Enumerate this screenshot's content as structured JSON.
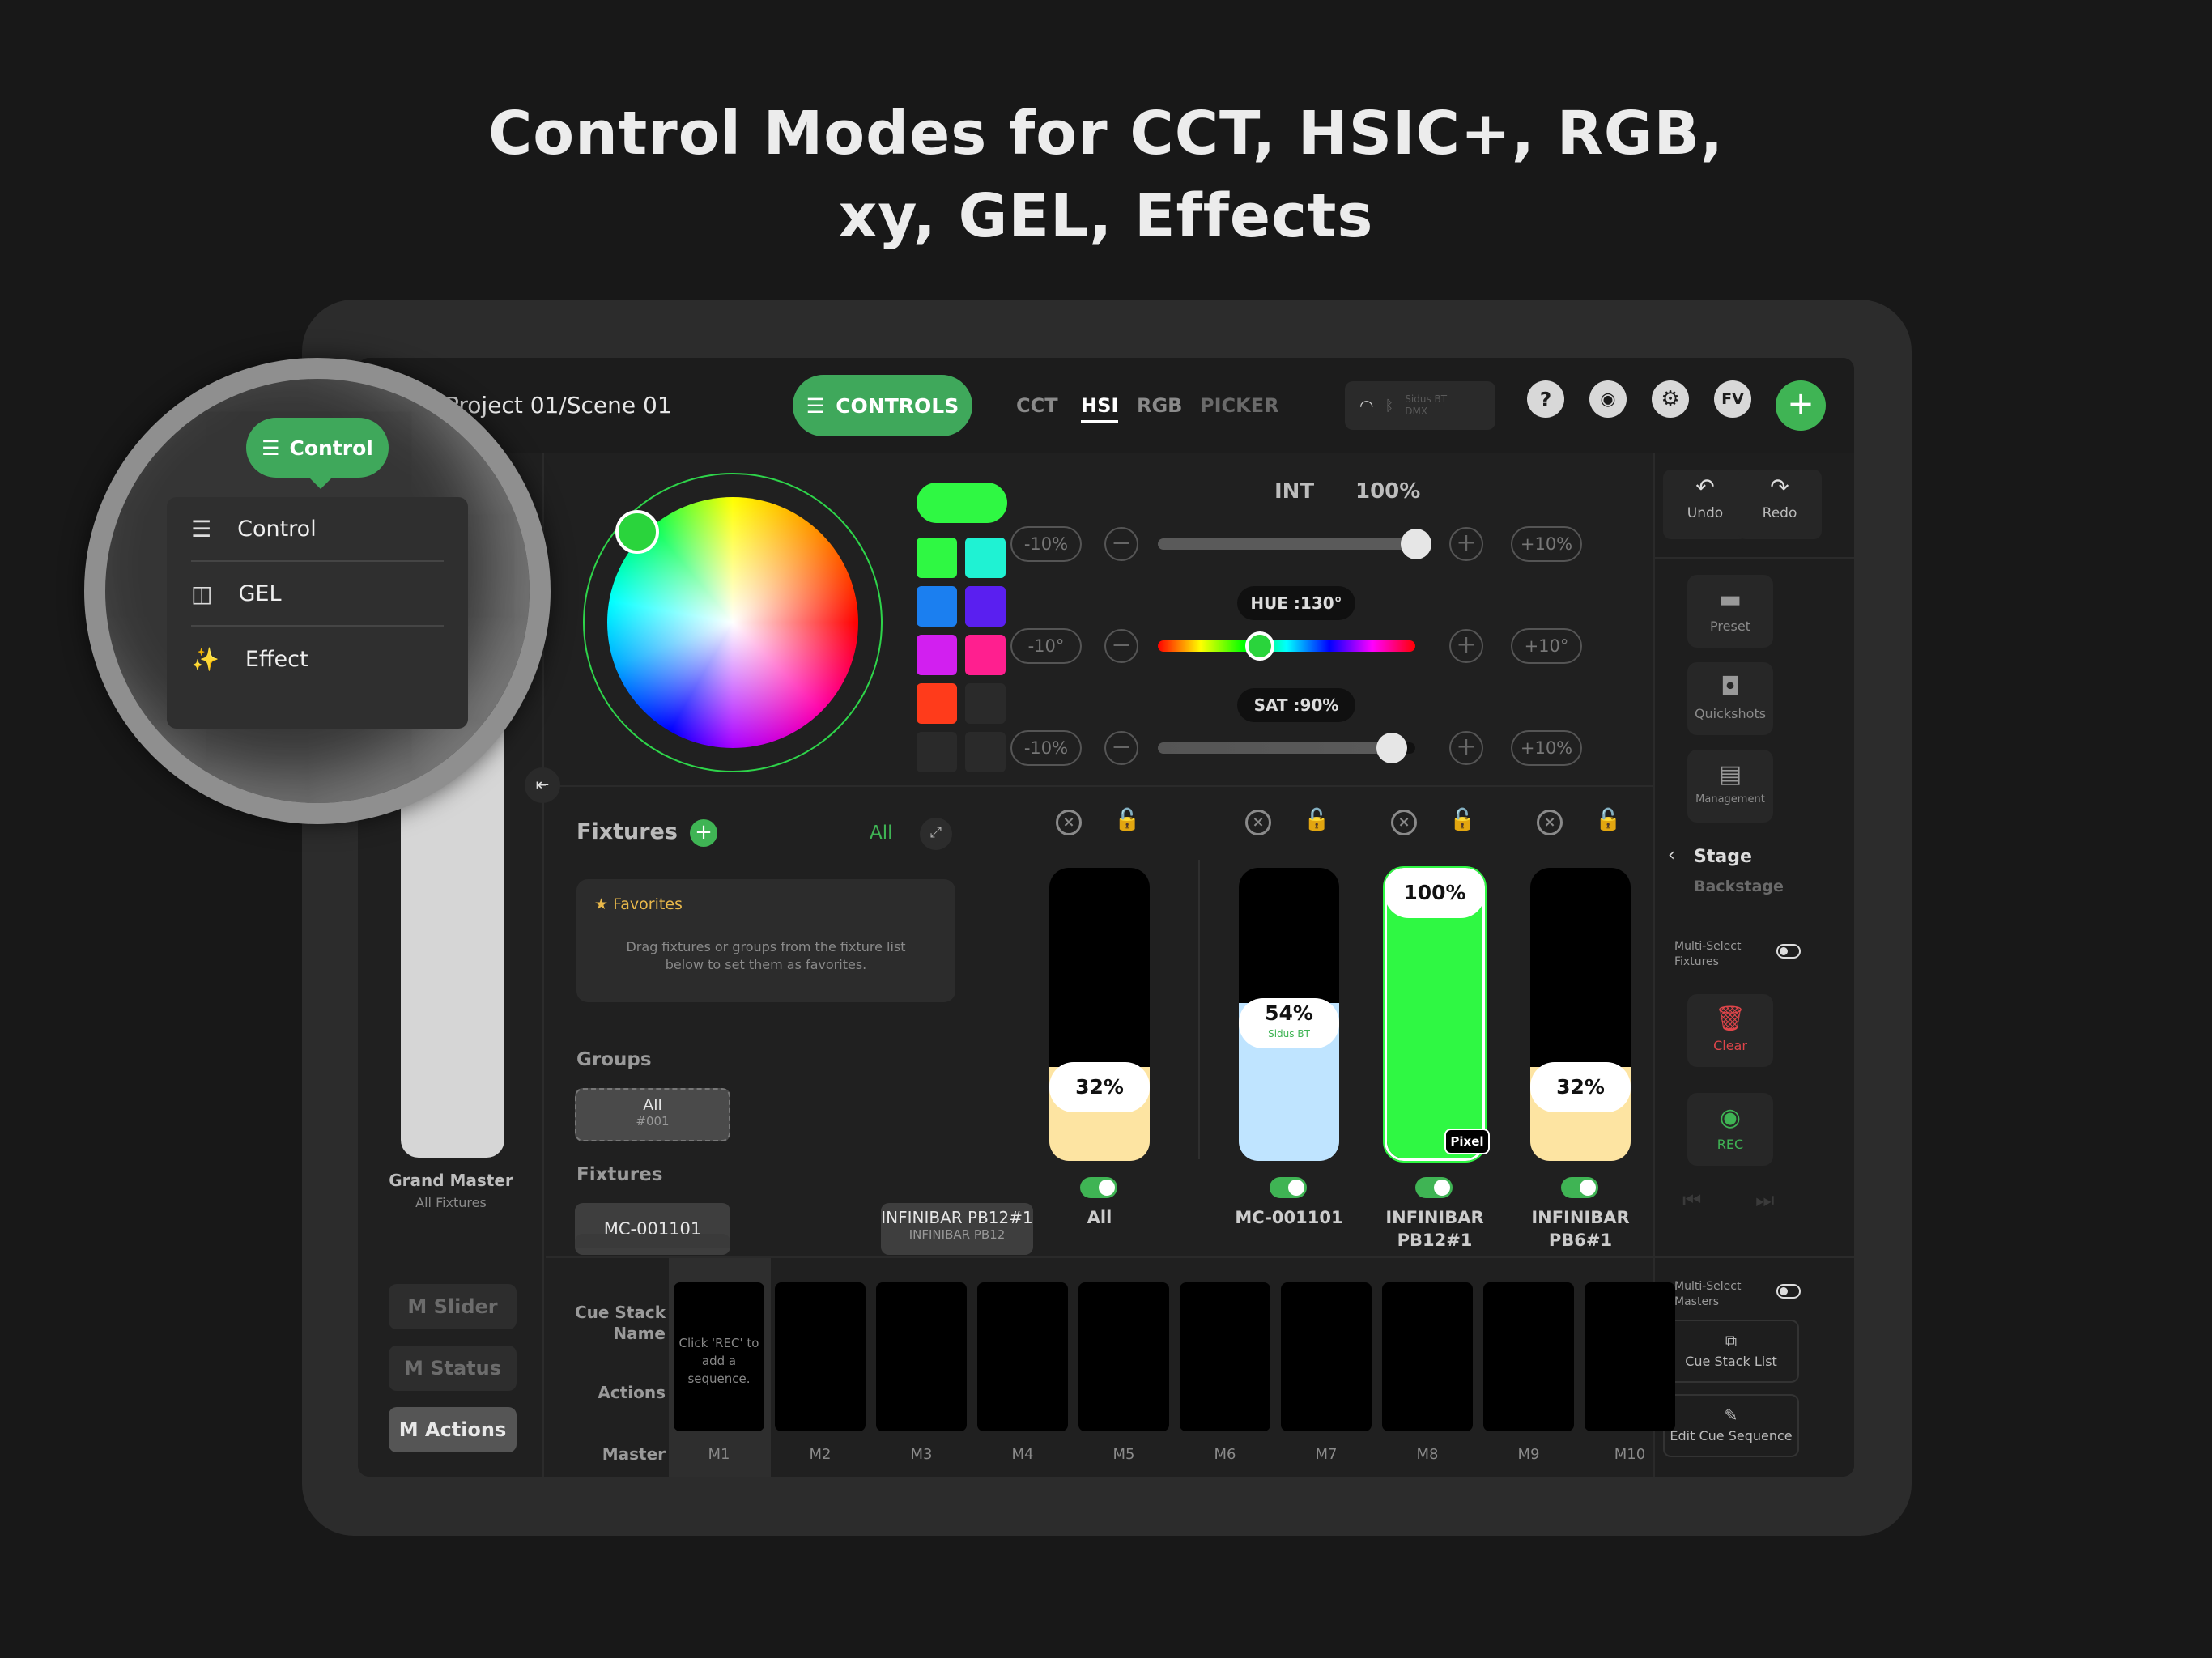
{
  "headline": {
    "line1": "Control Modes for CCT, HSIC+, RGB,",
    "line2": "xy, GEL, Effects"
  },
  "topbar": {
    "project": "Project 01/Scene 01",
    "controls_label": "CONTROLS",
    "tabs": [
      {
        "label": "CCT",
        "active": false
      },
      {
        "label": "HSI",
        "active": true
      },
      {
        "label": "RGB",
        "active": false
      },
      {
        "label": "PICKER",
        "active": false
      }
    ],
    "connection": {
      "line1": "Sidus BT",
      "line2": "DMX"
    },
    "user_initials": "FV",
    "help_label": "?",
    "add_label": "+"
  },
  "magnifier": {
    "button_label": "Control",
    "menu": [
      {
        "label": "Control",
        "icon": "sliders-icon"
      },
      {
        "label": "GEL",
        "icon": "gel-icon"
      },
      {
        "label": "Effect",
        "icon": "magic-wand-icon"
      }
    ]
  },
  "master": {
    "title": "Grand Master",
    "subtitle": "All Fixtures",
    "buttons": [
      {
        "label": "M Slider",
        "active": false
      },
      {
        "label": "M Status",
        "active": false
      },
      {
        "label": "M Actions",
        "active": true
      }
    ]
  },
  "color": {
    "swatches": [
      "#2ff843",
      "#1ff2d3",
      "#1b7ff0",
      "#5a1ff0",
      "#d21ff0",
      "#ff1f8f",
      "#ff3b1b",
      "#2a2a2a",
      "#2a2a2a",
      "#2a2a2a"
    ],
    "active_swatch": "#2ff843",
    "int_label": "INT",
    "int_value": "100%",
    "int_level": 1.0,
    "hue_tag": "HUE :130°",
    "hue_deg": 130,
    "sat_tag": "SAT :90%",
    "sat_level": 0.9,
    "rows": [
      {
        "left": "-10%",
        "right": "+10%"
      },
      {
        "left": "-10°",
        "right": "+10°"
      },
      {
        "left": "-10%",
        "right": "+10%"
      }
    ]
  },
  "fixtures_panel": {
    "title": "Fixtures",
    "filter": "All",
    "favorites_title": "Favorites",
    "favorites_hint_1": "Drag fixtures or groups from the fixture list",
    "favorites_hint_2": "below to set them as favorites.",
    "groups_title": "Groups",
    "group": {
      "name": "All",
      "id": "#001"
    },
    "fixtures_title": "Fixtures",
    "fixtures": [
      {
        "name": "MC-001101",
        "sub": ""
      },
      {
        "name": "INFINIBAR PB12#1",
        "sub": "INFINIBAR PB12"
      }
    ]
  },
  "faders": [
    {
      "label": "All",
      "label2": "",
      "value": "32%",
      "level": 0.32,
      "fill": "#fde4a2",
      "sub": "",
      "badge": ""
    },
    {
      "label": "MC-001101",
      "label2": "",
      "value": "54%",
      "level": 0.54,
      "fill": "#bfe4ff",
      "sub": "Sidus BT",
      "badge": ""
    },
    {
      "label": "INFINIBAR",
      "label2": "PB12#1",
      "value": "100%",
      "level": 1.0,
      "fill": "#2ff843",
      "sub": "",
      "badge": "Pixel"
    },
    {
      "label": "INFINIBAR",
      "label2": "PB6#1",
      "value": "32%",
      "level": 0.32,
      "fill": "#fde4a2",
      "sub": "",
      "badge": ""
    }
  ],
  "right": {
    "undo": "Undo",
    "redo": "Redo",
    "preset": "Preset",
    "quickshots": "Quickshots",
    "management": "Management",
    "stage": "Stage",
    "backstage": "Backstage",
    "multi_fixtures": "Multi-Select Fixtures",
    "clear": "Clear",
    "rec": "REC",
    "multi_masters": "Multi-Select Masters",
    "cue_list": "Cue Stack List",
    "edit_cue": "Edit Cue Sequence"
  },
  "cue": {
    "name_label_1": "Cue Stack",
    "name_label_2": "Name",
    "actions_label": "Actions",
    "master_label": "Master",
    "hint_1": "Click 'REC' to",
    "hint_2": "add a",
    "hint_3": "sequence.",
    "masters": [
      "M1",
      "M2",
      "M3",
      "M4",
      "M5",
      "M6",
      "M7",
      "M8",
      "M9",
      "M10"
    ]
  }
}
